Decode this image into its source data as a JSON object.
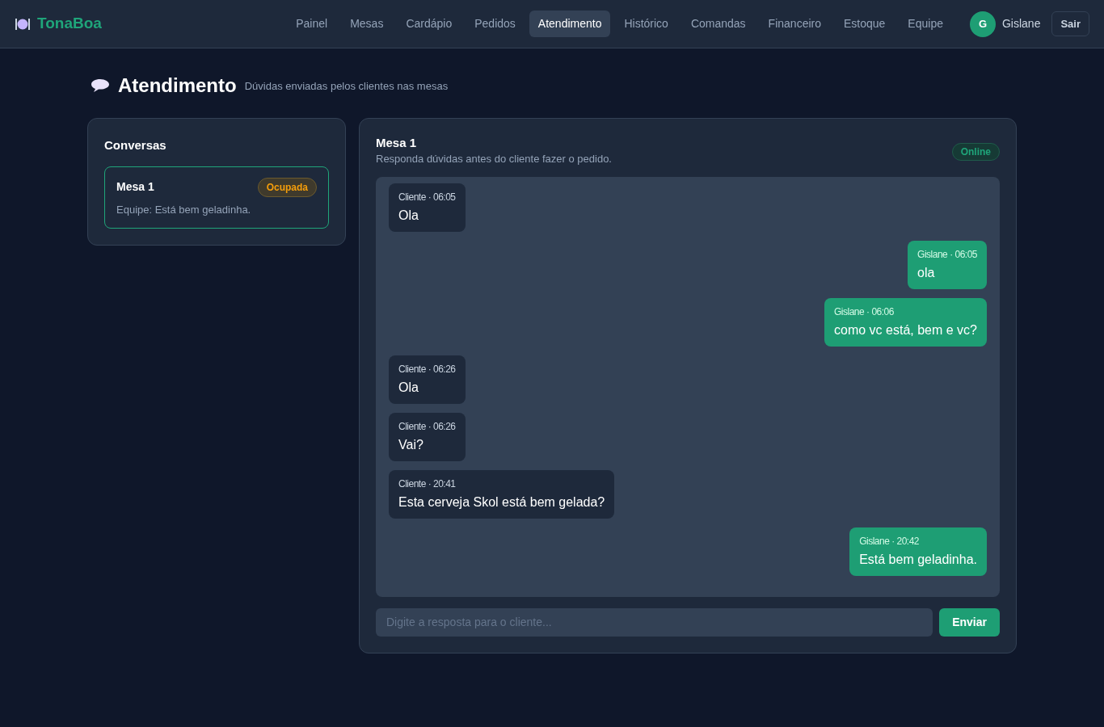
{
  "brand": "TonaBoa",
  "nav": [
    {
      "label": "Painel",
      "selected": false
    },
    {
      "label": "Mesas",
      "selected": false
    },
    {
      "label": "Cardápio",
      "selected": false
    },
    {
      "label": "Pedidos",
      "selected": false
    },
    {
      "label": "Atendimento",
      "selected": true
    },
    {
      "label": "Histórico",
      "selected": false
    },
    {
      "label": "Comandas",
      "selected": false
    },
    {
      "label": "Financeiro",
      "selected": false
    },
    {
      "label": "Estoque",
      "selected": false
    },
    {
      "label": "Equipe",
      "selected": false
    }
  ],
  "user": {
    "initial": "G",
    "name": "Gislane"
  },
  "logout": "Sair",
  "page": {
    "title": "Atendimento",
    "subtitle": "Dúvidas enviadas pelos clientes nas mesas"
  },
  "conversations": {
    "title": "Conversas",
    "items": [
      {
        "name": "Mesa 1",
        "status": "Ocupada",
        "preview": "Equipe: Está bem geladinha.",
        "selected": true
      }
    ]
  },
  "chat": {
    "title": "Mesa 1",
    "subtitle": "Responda dúvidas antes do cliente fazer o pedido.",
    "status": "Online",
    "messages": [
      {
        "kind": "incoming",
        "meta": "Cliente · 06:05",
        "text": "Ola"
      },
      {
        "kind": "outgoing",
        "meta": "Gislane · 06:05",
        "text": "ola"
      },
      {
        "kind": "outgoing",
        "meta": "Gislane · 06:06",
        "text": "como vc está, bem e vc?"
      },
      {
        "kind": "incoming",
        "meta": "Cliente · 06:26",
        "text": "Ola"
      },
      {
        "kind": "incoming",
        "meta": "Cliente · 06:26",
        "text": "Vai?"
      },
      {
        "kind": "incoming",
        "meta": "Cliente · 20:41",
        "text": "Esta cerveja Skol está bem gelada?"
      },
      {
        "kind": "outgoing",
        "meta": "Gislane · 20:42",
        "text": "Está bem geladinha."
      }
    ],
    "input": {
      "placeholder": "Digite a resposta para o cliente..."
    },
    "send": "Enviar"
  }
}
